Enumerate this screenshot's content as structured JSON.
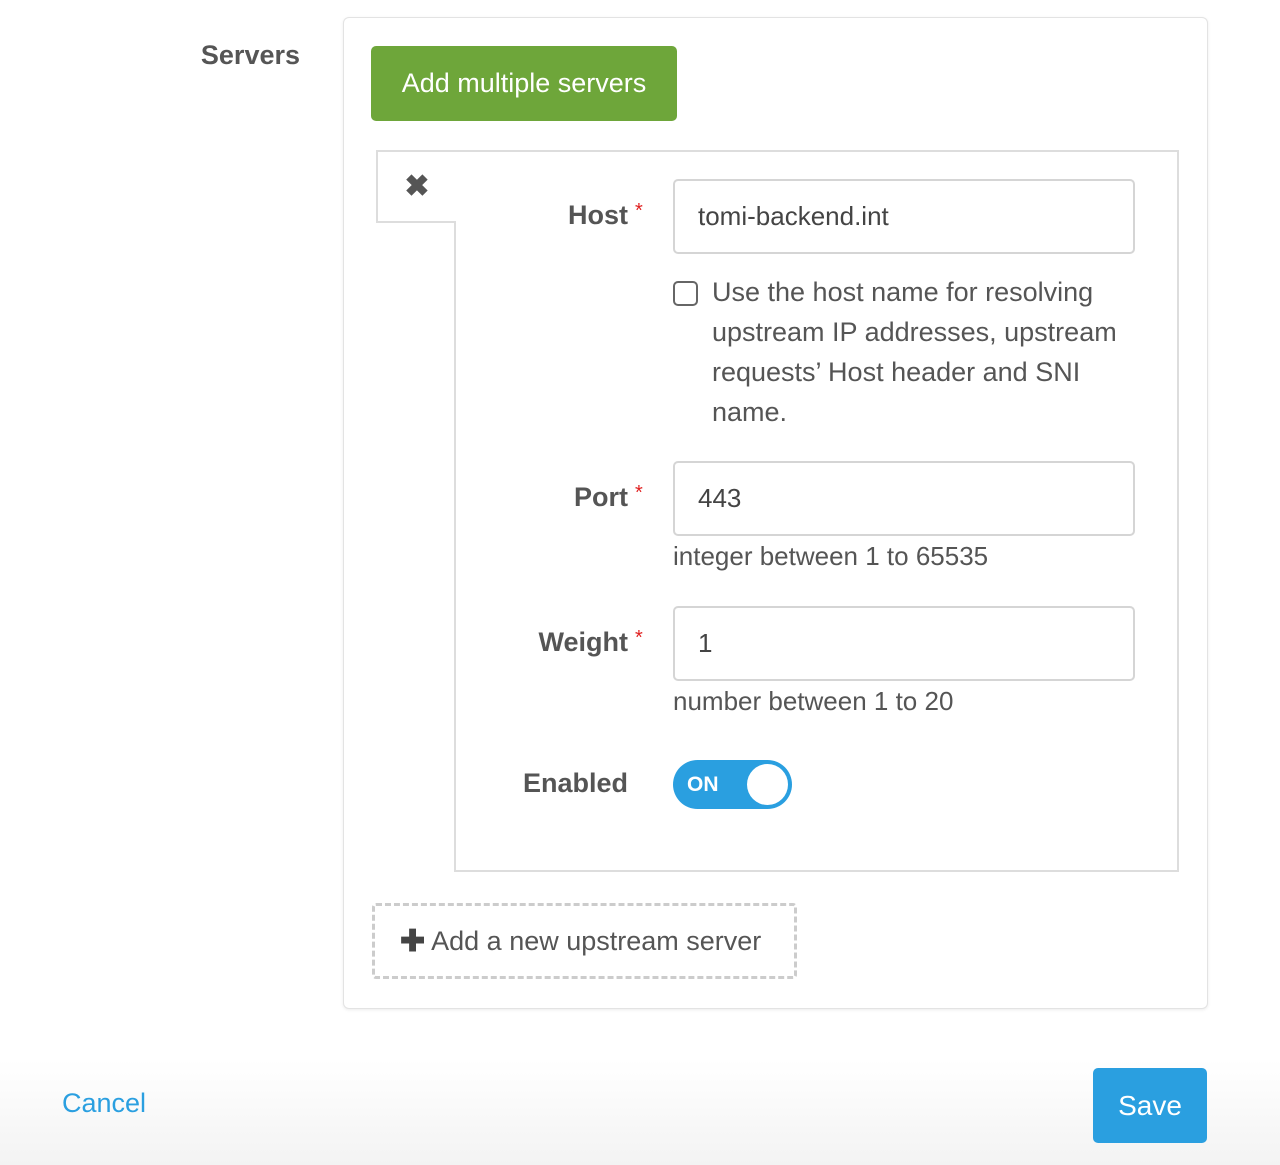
{
  "section_label": "Servers",
  "add_multiple_label": "Add multiple servers",
  "server": {
    "remove_icon": "close-icon",
    "host": {
      "label": "Host",
      "required_mark": "*",
      "value": "tomi-backend.int"
    },
    "use_host_checkbox": {
      "checked": false,
      "label": "Use the host name for resolving upstream IP addresses, upstream requests’ Host header and SNI name."
    },
    "port": {
      "label": "Port",
      "required_mark": "*",
      "value": "443",
      "hint": "integer between 1 to 65535"
    },
    "weight": {
      "label": "Weight",
      "required_mark": "*",
      "value": "1",
      "hint": "number between 1 to 20"
    },
    "enabled": {
      "label": "Enabled",
      "state": "ON",
      "on": true
    }
  },
  "add_new_label": "Add a new upstream server",
  "cancel_label": "Cancel",
  "save_label": "Save",
  "colors": {
    "green": "#6ea63a",
    "blue": "#2a9fe0",
    "required": "#e02020"
  }
}
